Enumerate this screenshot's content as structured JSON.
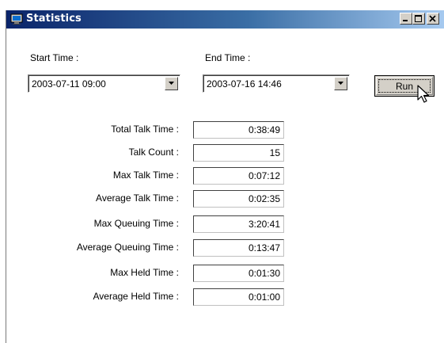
{
  "window": {
    "title": "Statistics",
    "controls": [
      "minimize-icon",
      "maximize-icon",
      "close-icon"
    ]
  },
  "filters": {
    "start_label": "Start Time :",
    "start_value": "2003-07-11 09:00",
    "end_label": "End Time :",
    "end_value": "2003-07-16 14:46",
    "run_label": "Run"
  },
  "stats": [
    {
      "label": "Total Talk Time :",
      "value": "0:38:49"
    },
    {
      "label": "Talk Count :",
      "value": "15"
    },
    {
      "label": "Max Talk Time :",
      "value": "0:07:12"
    },
    {
      "label": "Average Talk Time :",
      "value": "0:02:35"
    },
    {
      "label": "Max Queuing Time :",
      "value": "3:20:41"
    },
    {
      "label": "Average Queuing Time :",
      "value": "0:13:47"
    },
    {
      "label": "Max Held Time :",
      "value": "0:01:30"
    },
    {
      "label": "Average Held Time :",
      "value": "0:01:00"
    }
  ],
  "colors": {
    "titlebar_start": "#0a246a",
    "titlebar_end": "#a6caf0",
    "face": "#d4d0c8"
  }
}
